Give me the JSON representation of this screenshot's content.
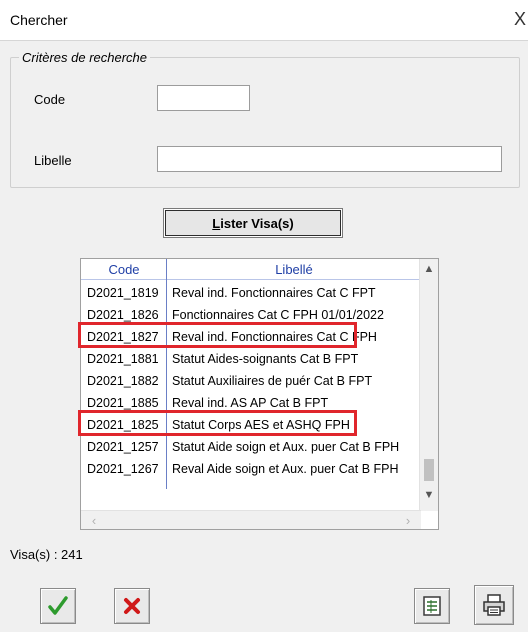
{
  "window": {
    "title": "Chercher",
    "close_glyph": "X"
  },
  "criteria": {
    "legend": "Critères de recherche",
    "code_label": "Code",
    "code_value": "",
    "libelle_label": "Libelle",
    "libelle_value": ""
  },
  "list_button": {
    "label_prefix": "L",
    "label_rest": "ister Visa(s)"
  },
  "table": {
    "columns": [
      "Code",
      "Libellé"
    ],
    "rows": [
      {
        "code": "D2021_1819",
        "libelle": "Reval ind. Fonctionnaires Cat C FPT"
      },
      {
        "code": "D2021_1826",
        "libelle": "Fonctionnaires Cat C FPH 01/01/2022"
      },
      {
        "code": "D2021_1827",
        "libelle": "Reval ind. Fonctionnaires Cat C FPH"
      },
      {
        "code": "D2021_1881",
        "libelle": "Statut Aides-soignants Cat B FPT"
      },
      {
        "code": "D2021_1882",
        "libelle": "Statut Auxiliaires de puér Cat B FPT"
      },
      {
        "code": "D2021_1885",
        "libelle": "Reval ind. AS AP Cat B FPT"
      },
      {
        "code": "D2021_1825",
        "libelle": "Statut Corps AES et ASHQ FPH"
      },
      {
        "code": "D2021_1257",
        "libelle": "Statut Aide soign et Aux. puer Cat B FPH"
      },
      {
        "code": "D2021_1267",
        "libelle": "Reval Aide soign et Aux. puer Cat B FPH"
      }
    ],
    "highlighted_rows": [
      "D2021_1827",
      "D2021_1825"
    ],
    "highlight_color": "#e0262c",
    "header_color": "#1f3fa6"
  },
  "footer": {
    "count_text": "Visa(s) : 241"
  },
  "icons": {
    "ok": "green-checkmark-icon",
    "cancel": "red-x-icon",
    "export": "spreadsheet-icon",
    "print": "printer-icon"
  }
}
